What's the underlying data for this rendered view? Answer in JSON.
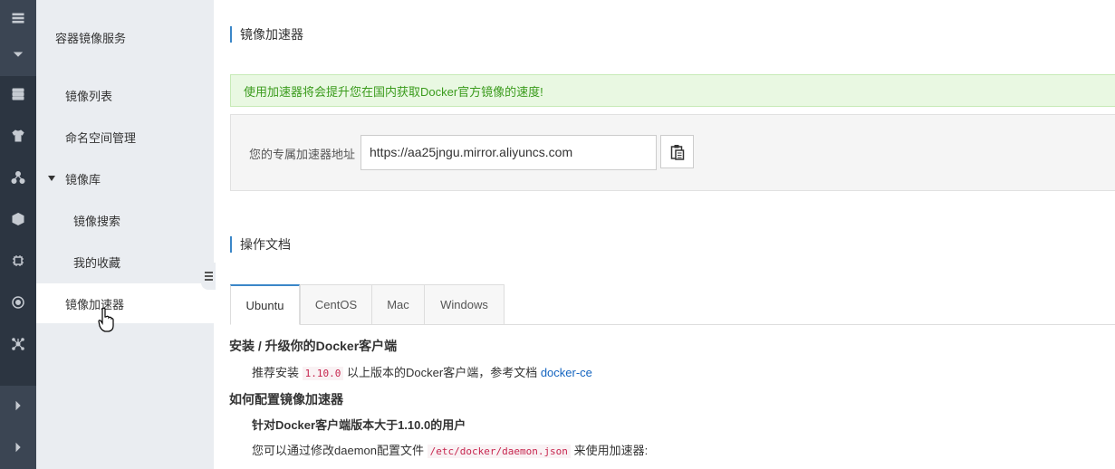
{
  "sidebar": {
    "title": "容器镜像服务",
    "items": [
      {
        "label": "镜像列表"
      },
      {
        "label": "命名空间管理"
      },
      {
        "label": "镜像库"
      },
      {
        "label": "镜像搜索"
      },
      {
        "label": "我的收藏"
      },
      {
        "label": "镜像加速器"
      }
    ]
  },
  "main": {
    "title": "镜像加速器",
    "alert": "使用加速器将会提升您在国内获取Docker官方镜像的速度!",
    "accelerator": {
      "label": "您的专属加速器地址",
      "url": "https://aa25jngu.mirror.aliyuncs.com"
    },
    "docs_title": "操作文档",
    "tabs": [
      "Ubuntu",
      "CentOS",
      "Mac",
      "Windows"
    ],
    "active_tab": "Ubuntu",
    "docs": {
      "h1": "安装 / 升级你的Docker客户端",
      "p1_prefix": "推荐安装",
      "p1_version": "1.10.0",
      "p1_middle": "以上版本的Docker客户端，参考文档",
      "p1_link": "docker-ce",
      "h2": "如何配置镜像加速器",
      "h3": "针对Docker客户端版本大于1.10.0的用户",
      "p2_prefix": "您可以通过修改daemon配置文件",
      "p2_path": "/etc/docker/daemon.json",
      "p2_suffix": "来使用加速器:"
    }
  },
  "colors": {
    "rail_bg": "#2c3541",
    "sidebar_bg": "#eaedf1",
    "accent": "#3b87c8",
    "alert_text": "#3a9b1c",
    "alert_bg": "#e9f8e2"
  }
}
